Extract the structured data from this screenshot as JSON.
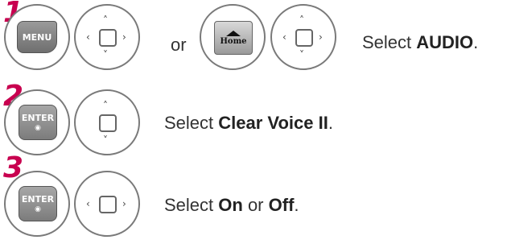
{
  "steps": [
    {
      "number": "1",
      "key_label": "MENU",
      "or_text": "or",
      "home_label": "Home",
      "instruction_prefix": "Select ",
      "instruction_bold": "AUDIO",
      "instruction_suffix": "."
    },
    {
      "number": "2",
      "key_label": "ENTER",
      "key_dot": "◉",
      "instruction_prefix": "Select ",
      "instruction_bold": "Clear Voice II",
      "instruction_suffix": "."
    },
    {
      "number": "3",
      "key_label": "ENTER",
      "key_dot": "◉",
      "instruction_prefix": "Select ",
      "instruction_bold": "On",
      "instruction_middle": " or ",
      "instruction_bold2": "Off",
      "instruction_suffix": "."
    }
  ],
  "arrows": {
    "up": "˄",
    "down": "˅",
    "left": "‹",
    "right": "›"
  },
  "colors": {
    "step_number": "#c8004f",
    "circle_border": "#7a7a7a"
  }
}
